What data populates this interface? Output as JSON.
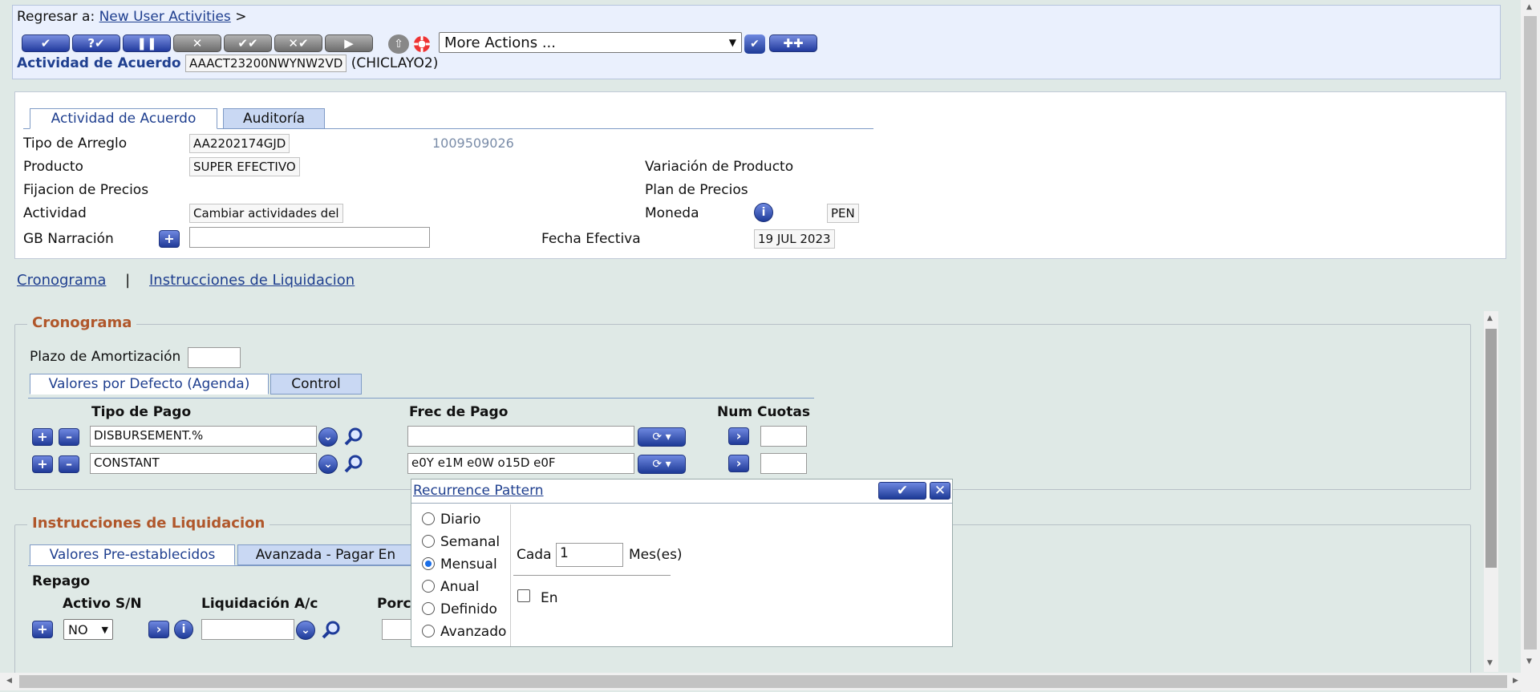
{
  "header": {
    "back_prefix": "Regresar a:",
    "back_link": "New User Activities",
    "back_sep": ">",
    "more_actions": "More Actions ...",
    "activity_label": "Actividad de Acuerdo",
    "activity_id": "AAACT23200NWYNW2VD",
    "activity_branch": "(CHICLAYO2)"
  },
  "tabs": {
    "main": "Actividad de Acuerdo",
    "audit": "Auditoría"
  },
  "form": {
    "tipo_arreglo_label": "Tipo de Arreglo",
    "tipo_arreglo_value": "AA2202174GJD",
    "customer_id": "1009509026",
    "producto_label": "Producto",
    "producto_value": "SUPER EFECTIVO",
    "variacion_label": "Variación de Producto",
    "fijacion_label": "Fijacion de Precios",
    "plan_label": "Plan de Precios",
    "actividad_label": "Actividad",
    "actividad_value": "Cambiar actividades del",
    "moneda_label": "Moneda",
    "moneda_value": "PEN",
    "narracion_label": "GB Narración",
    "fecha_label": "Fecha Efectiva",
    "fecha_value": "19 JUL 2023"
  },
  "links": {
    "cronograma": "Cronograma",
    "sep": "|",
    "instrucciones": "Instrucciones de Liquidacion"
  },
  "cronograma": {
    "legend": "Cronograma",
    "plazo_label": "Plazo de Amortización",
    "tab_defaults": "Valores por Defecto (Agenda)",
    "tab_control": "Control",
    "col_tipo": "Tipo de Pago",
    "col_frec": "Frec de Pago",
    "col_num": "Num Cuotas",
    "rows": [
      {
        "tipo": "DISBURSEMENT.%",
        "frec": ""
      },
      {
        "tipo": "CONSTANT",
        "frec": "e0Y e1M e0W o15D e0F"
      }
    ]
  },
  "liquidacion": {
    "legend": "Instrucciones de Liquidacion",
    "tab_pre": "Valores Pre-establecidos",
    "tab_avanzada": "Avanzada - Pagar En",
    "repago": "Repago",
    "activo_label": "Activo S/N",
    "activo_value": "NO",
    "liq_label": "Liquidación A/c",
    "porc_label": "Porc"
  },
  "popup": {
    "title": "Recurrence Pattern",
    "options": [
      "Diario",
      "Semanal",
      "Mensual",
      "Anual",
      "Definido",
      "Avanzado"
    ],
    "selected": "Mensual",
    "cada_label": "Cada",
    "cada_value": "1",
    "unit": "Mes(es)",
    "en_label": "En"
  },
  "icons": {
    "ok": "check-icon",
    "lifebuoy": "lifebuoy-icon",
    "info": "info-icon",
    "search": "magnifier-icon"
  },
  "colors": {
    "accent": "#1f3f8f",
    "legend": "#b0572b"
  }
}
